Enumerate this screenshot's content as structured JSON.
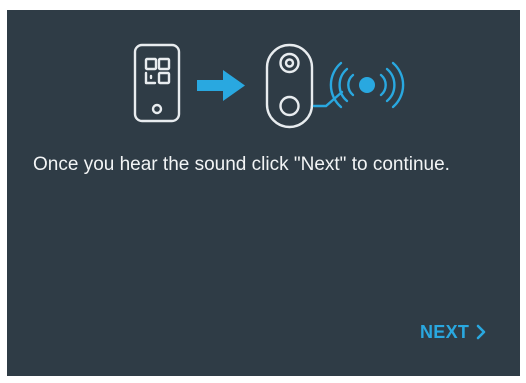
{
  "dialog": {
    "instruction": "Once you hear the sound click \"Next\" to continue.",
    "next_label": "NEXT",
    "next_icon": "chevron-right-icon"
  },
  "illustration": {
    "icons": [
      "phone-qr-icon",
      "arrow-right-icon",
      "doorbell-icon",
      "sound-waves-icon"
    ]
  },
  "colors": {
    "panel_background": "#2f3c46",
    "text": "#f2f4f5",
    "accent": "#29a8e0",
    "line_art": "#e8ecef"
  }
}
